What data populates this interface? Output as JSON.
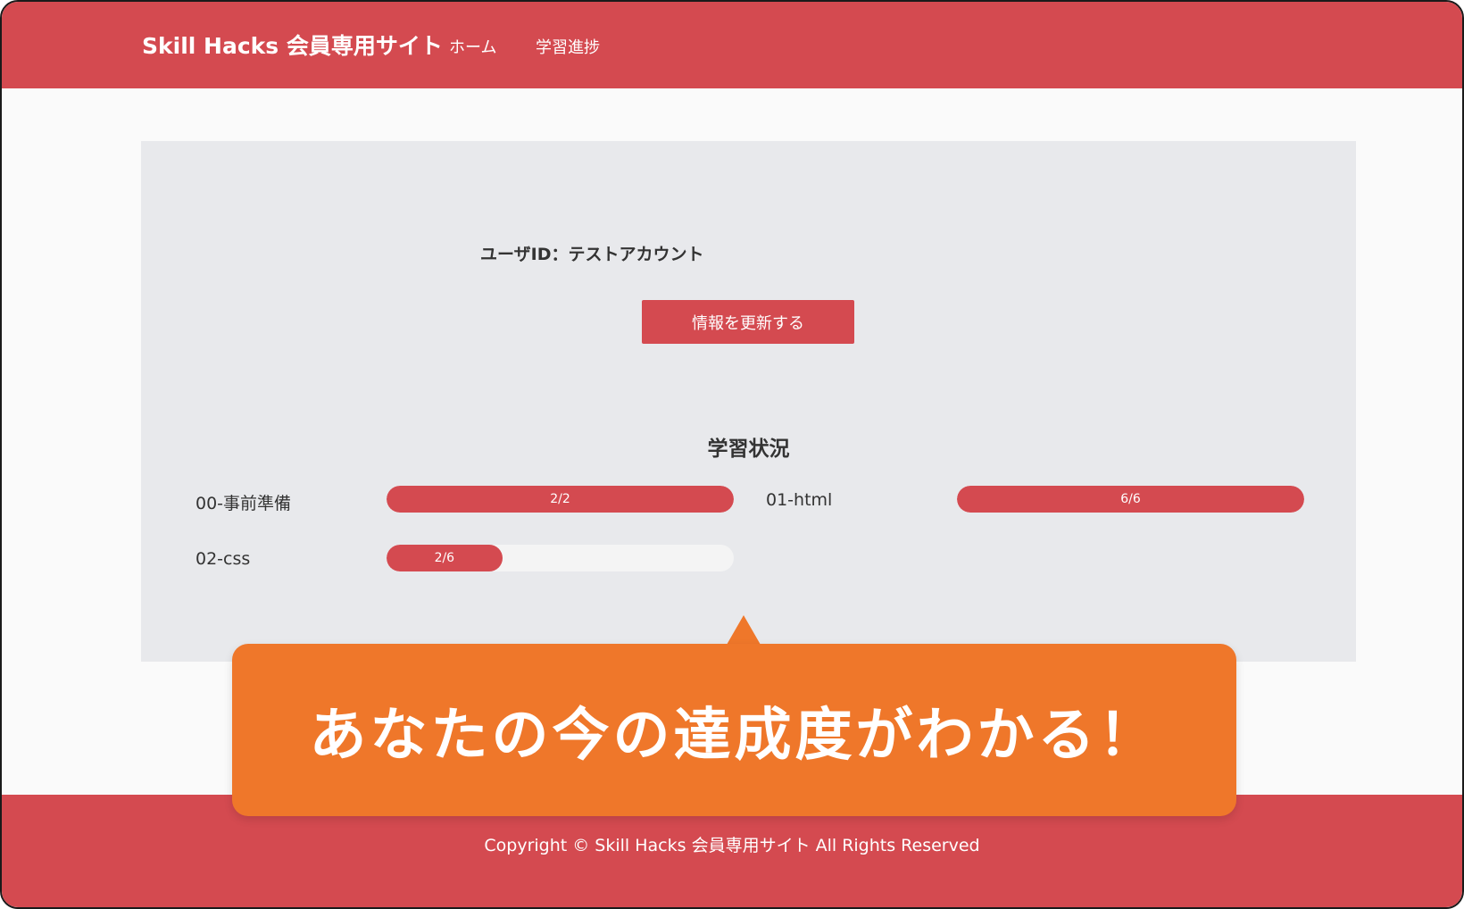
{
  "header": {
    "brand": "Skill Hacks 会員専用サイト",
    "nav": [
      {
        "label": "ホーム"
      },
      {
        "label": "学習進捗"
      }
    ]
  },
  "profile": {
    "user_id_text": "ユーザID：テストアカウント",
    "update_button": "情報を更新する"
  },
  "progress": {
    "title": "学習状況",
    "courses": [
      {
        "name": "00-事前準備",
        "completed": 2,
        "total": 2,
        "label": "2/2"
      },
      {
        "name": "01-html",
        "completed": 6,
        "total": 6,
        "label": "6/6"
      },
      {
        "name": "02-css",
        "completed": 2,
        "total": 6,
        "label": "2/6"
      }
    ]
  },
  "callout": {
    "text": "あなたの今の達成度がわかる！"
  },
  "footer": {
    "copyright": "Copyright © Skill Hacks 会員専用サイト All Rights Reserved"
  },
  "colors": {
    "brand": "#d44a50",
    "card_bg": "#e8e9ec",
    "callout": "#ef772a"
  }
}
